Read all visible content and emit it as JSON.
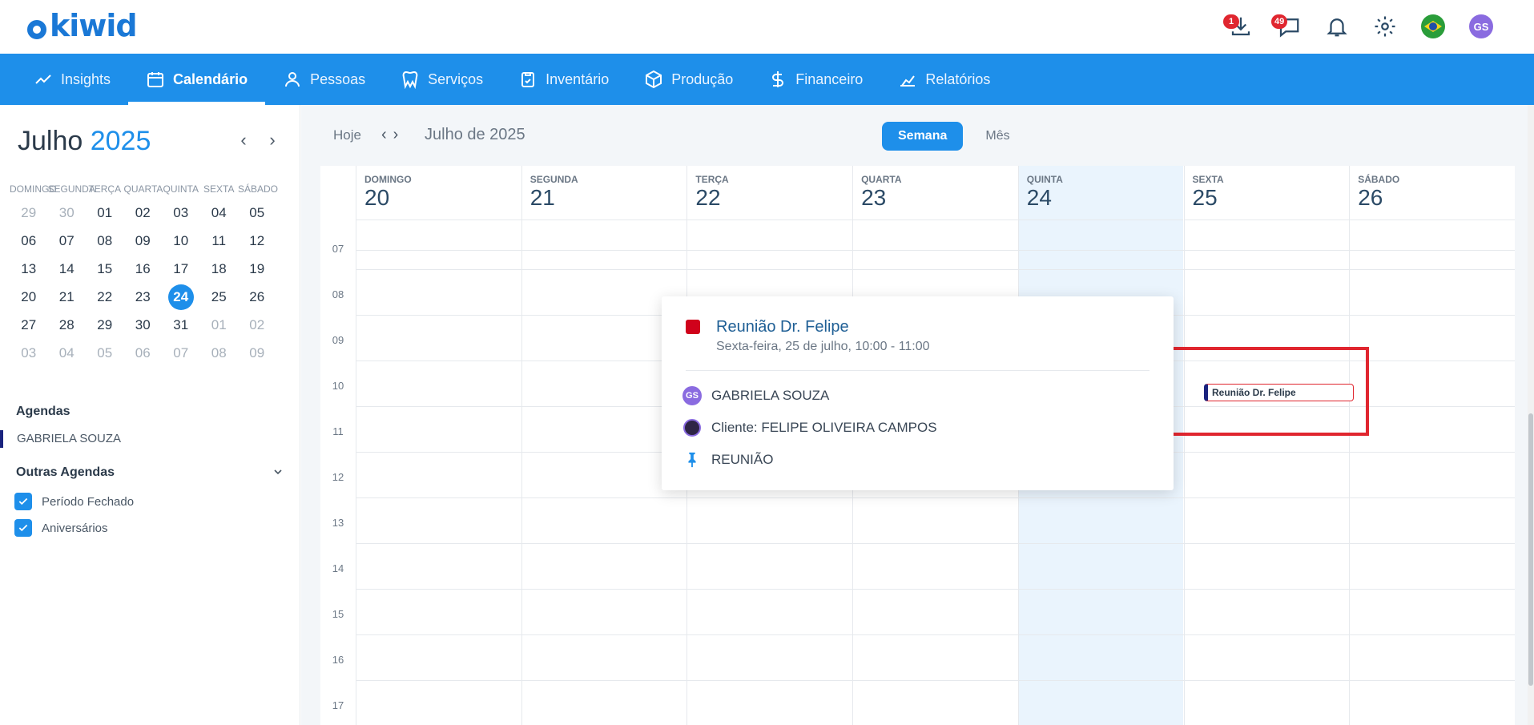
{
  "app": {
    "logo": "kiwid"
  },
  "topbar": {
    "download_badge": "1",
    "chat_badge": "49",
    "avatar": "GS",
    "icons": [
      "download-icon",
      "chat-icon",
      "bell-icon",
      "gear-icon",
      "brazil-flag-icon",
      "avatar"
    ]
  },
  "nav": {
    "items": [
      {
        "label": "Insights",
        "icon": "trend-icon"
      },
      {
        "label": "Calendário",
        "icon": "calendar-icon",
        "active": true
      },
      {
        "label": "Pessoas",
        "icon": "person-icon"
      },
      {
        "label": "Serviços",
        "icon": "tooth-icon"
      },
      {
        "label": "Inventário",
        "icon": "clipboard-icon"
      },
      {
        "label": "Produção",
        "icon": "box-icon"
      },
      {
        "label": "Financeiro",
        "icon": "dollar-icon"
      },
      {
        "label": "Relatórios",
        "icon": "chart-icon"
      }
    ]
  },
  "mini_calendar": {
    "month": "Julho",
    "year": "2025",
    "weekdays": [
      "DOMINGO",
      "SEGUNDA",
      "TERÇA",
      "QUARTA",
      "QUINTA",
      "SEXTA",
      "SÁBADO"
    ],
    "weeks": [
      [
        "29",
        "30",
        "01",
        "02",
        "03",
        "04",
        "05"
      ],
      [
        "06",
        "07",
        "08",
        "09",
        "10",
        "11",
        "12"
      ],
      [
        "13",
        "14",
        "15",
        "16",
        "17",
        "18",
        "19"
      ],
      [
        "20",
        "21",
        "22",
        "23",
        "24",
        "25",
        "26"
      ],
      [
        "27",
        "28",
        "29",
        "30",
        "31",
        "01",
        "02"
      ],
      [
        "03",
        "04",
        "05",
        "06",
        "07",
        "08",
        "09"
      ]
    ],
    "today": "24"
  },
  "sidebar": {
    "agendas_title": "Agendas",
    "agenda_user": "GABRIELA SOUZA",
    "outras_title": "Outras Agendas",
    "outras": [
      {
        "label": "Período Fechado",
        "checked": true
      },
      {
        "label": "Aniversários",
        "checked": true
      }
    ]
  },
  "toolbar": {
    "today_label": "Hoje",
    "title": "Julho de 2025",
    "views": [
      {
        "label": "Semana",
        "active": true
      },
      {
        "label": "Mês",
        "active": false
      }
    ]
  },
  "week": {
    "days": [
      {
        "name": "DOMINGO",
        "date": "20"
      },
      {
        "name": "SEGUNDA",
        "date": "21"
      },
      {
        "name": "TERÇA",
        "date": "22"
      },
      {
        "name": "QUARTA",
        "date": "23"
      },
      {
        "name": "QUINTA",
        "date": "24",
        "today": true
      },
      {
        "name": "SEXTA",
        "date": "25"
      },
      {
        "name": "SÁBADO",
        "date": "26"
      }
    ],
    "hours": [
      "07",
      "08",
      "09",
      "10",
      "11",
      "12",
      "13",
      "14",
      "15",
      "16",
      "17"
    ]
  },
  "event": {
    "title": "Reunião Dr. Felipe",
    "border_color": "#e0262f",
    "marker_color": "#1a237e"
  },
  "popup": {
    "title": "Reunião Dr. Felipe",
    "subtitle": "Sexta-feira, 25 de julho, 10:00 - 11:00",
    "owner_initials": "GS",
    "owner": "GABRIELA SOUZA",
    "client": "Cliente: FELIPE OLIVEIRA CAMPOS",
    "type": "REUNIÃO",
    "color": "#d0021b"
  },
  "colors": {
    "primary": "#1e8fea",
    "today_bg": "#eaf4fd",
    "highlight": "#e0262f"
  }
}
